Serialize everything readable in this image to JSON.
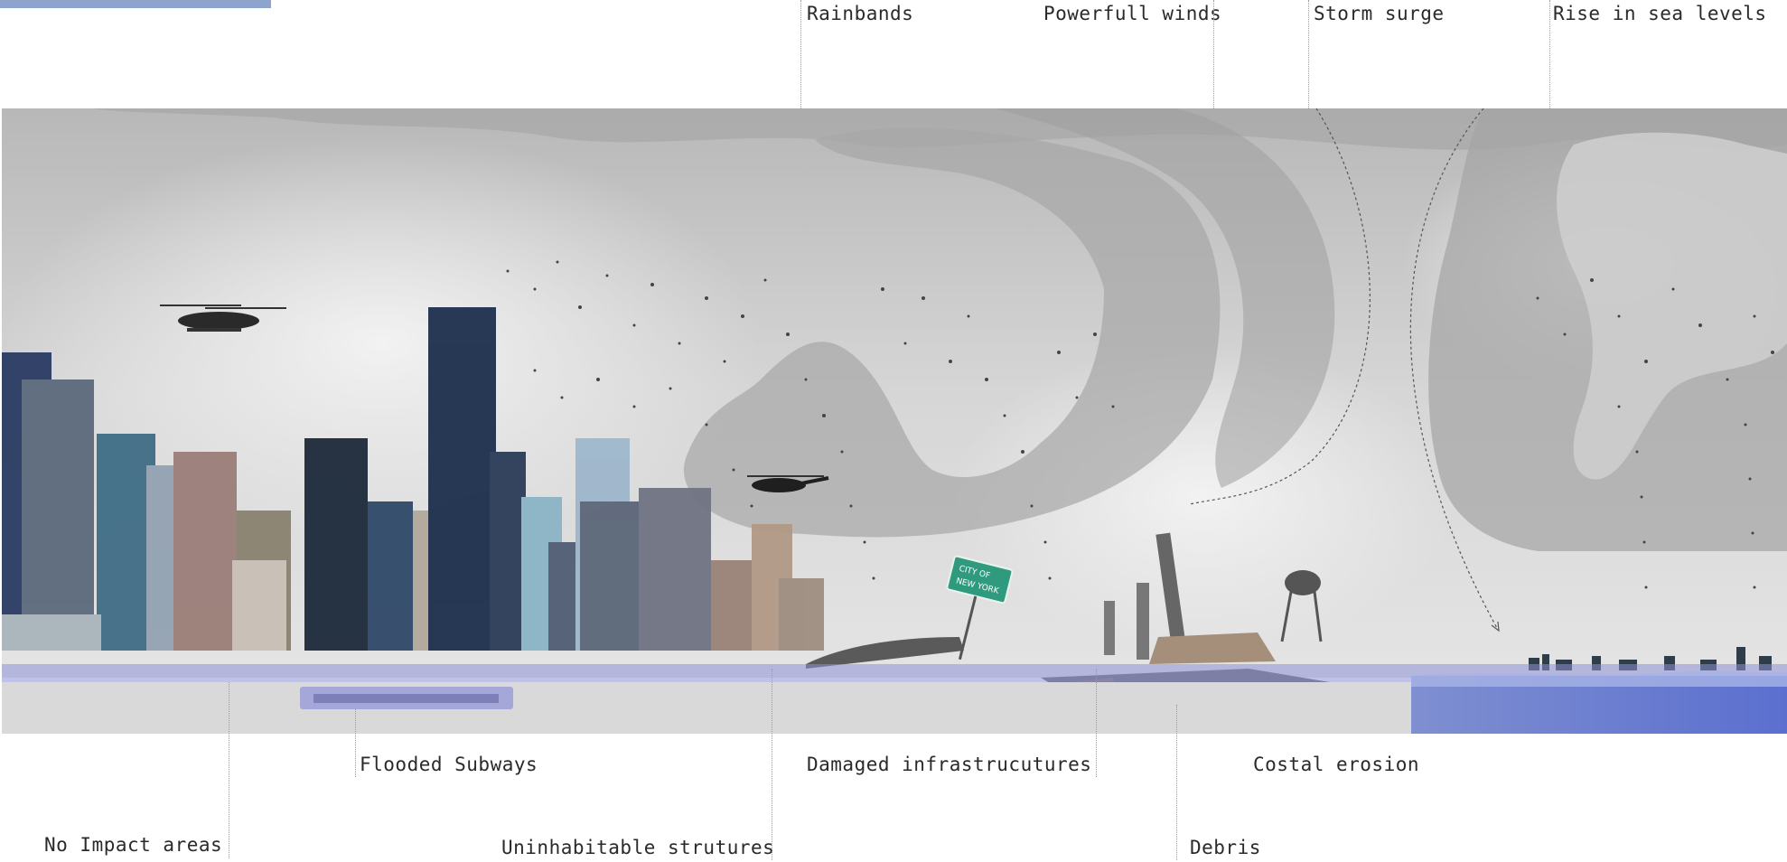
{
  "colors": {
    "accent_tag": "#8fa4cc",
    "flood_water": "#8c8fd6",
    "sky": "#c9c9c9",
    "cloud_mass": "#a9a9a9",
    "ground": "#d9d9d9"
  },
  "labels": {
    "top": {
      "rainbands": "Rainbands",
      "winds": "Powerfull winds",
      "surge": "Storm surge",
      "sea_levels": "Rise in sea levels"
    },
    "bottom": {
      "subways": "Flooded Subways",
      "infrastructures": "Damaged infrastrucutures",
      "erosion": "Costal erosion",
      "no_impact": "No Impact areas",
      "structures": "Uninhabitable strutures",
      "debris": "Debris"
    }
  },
  "sign": {
    "line1": "CITY OF",
    "line2": "NEW YORK"
  }
}
